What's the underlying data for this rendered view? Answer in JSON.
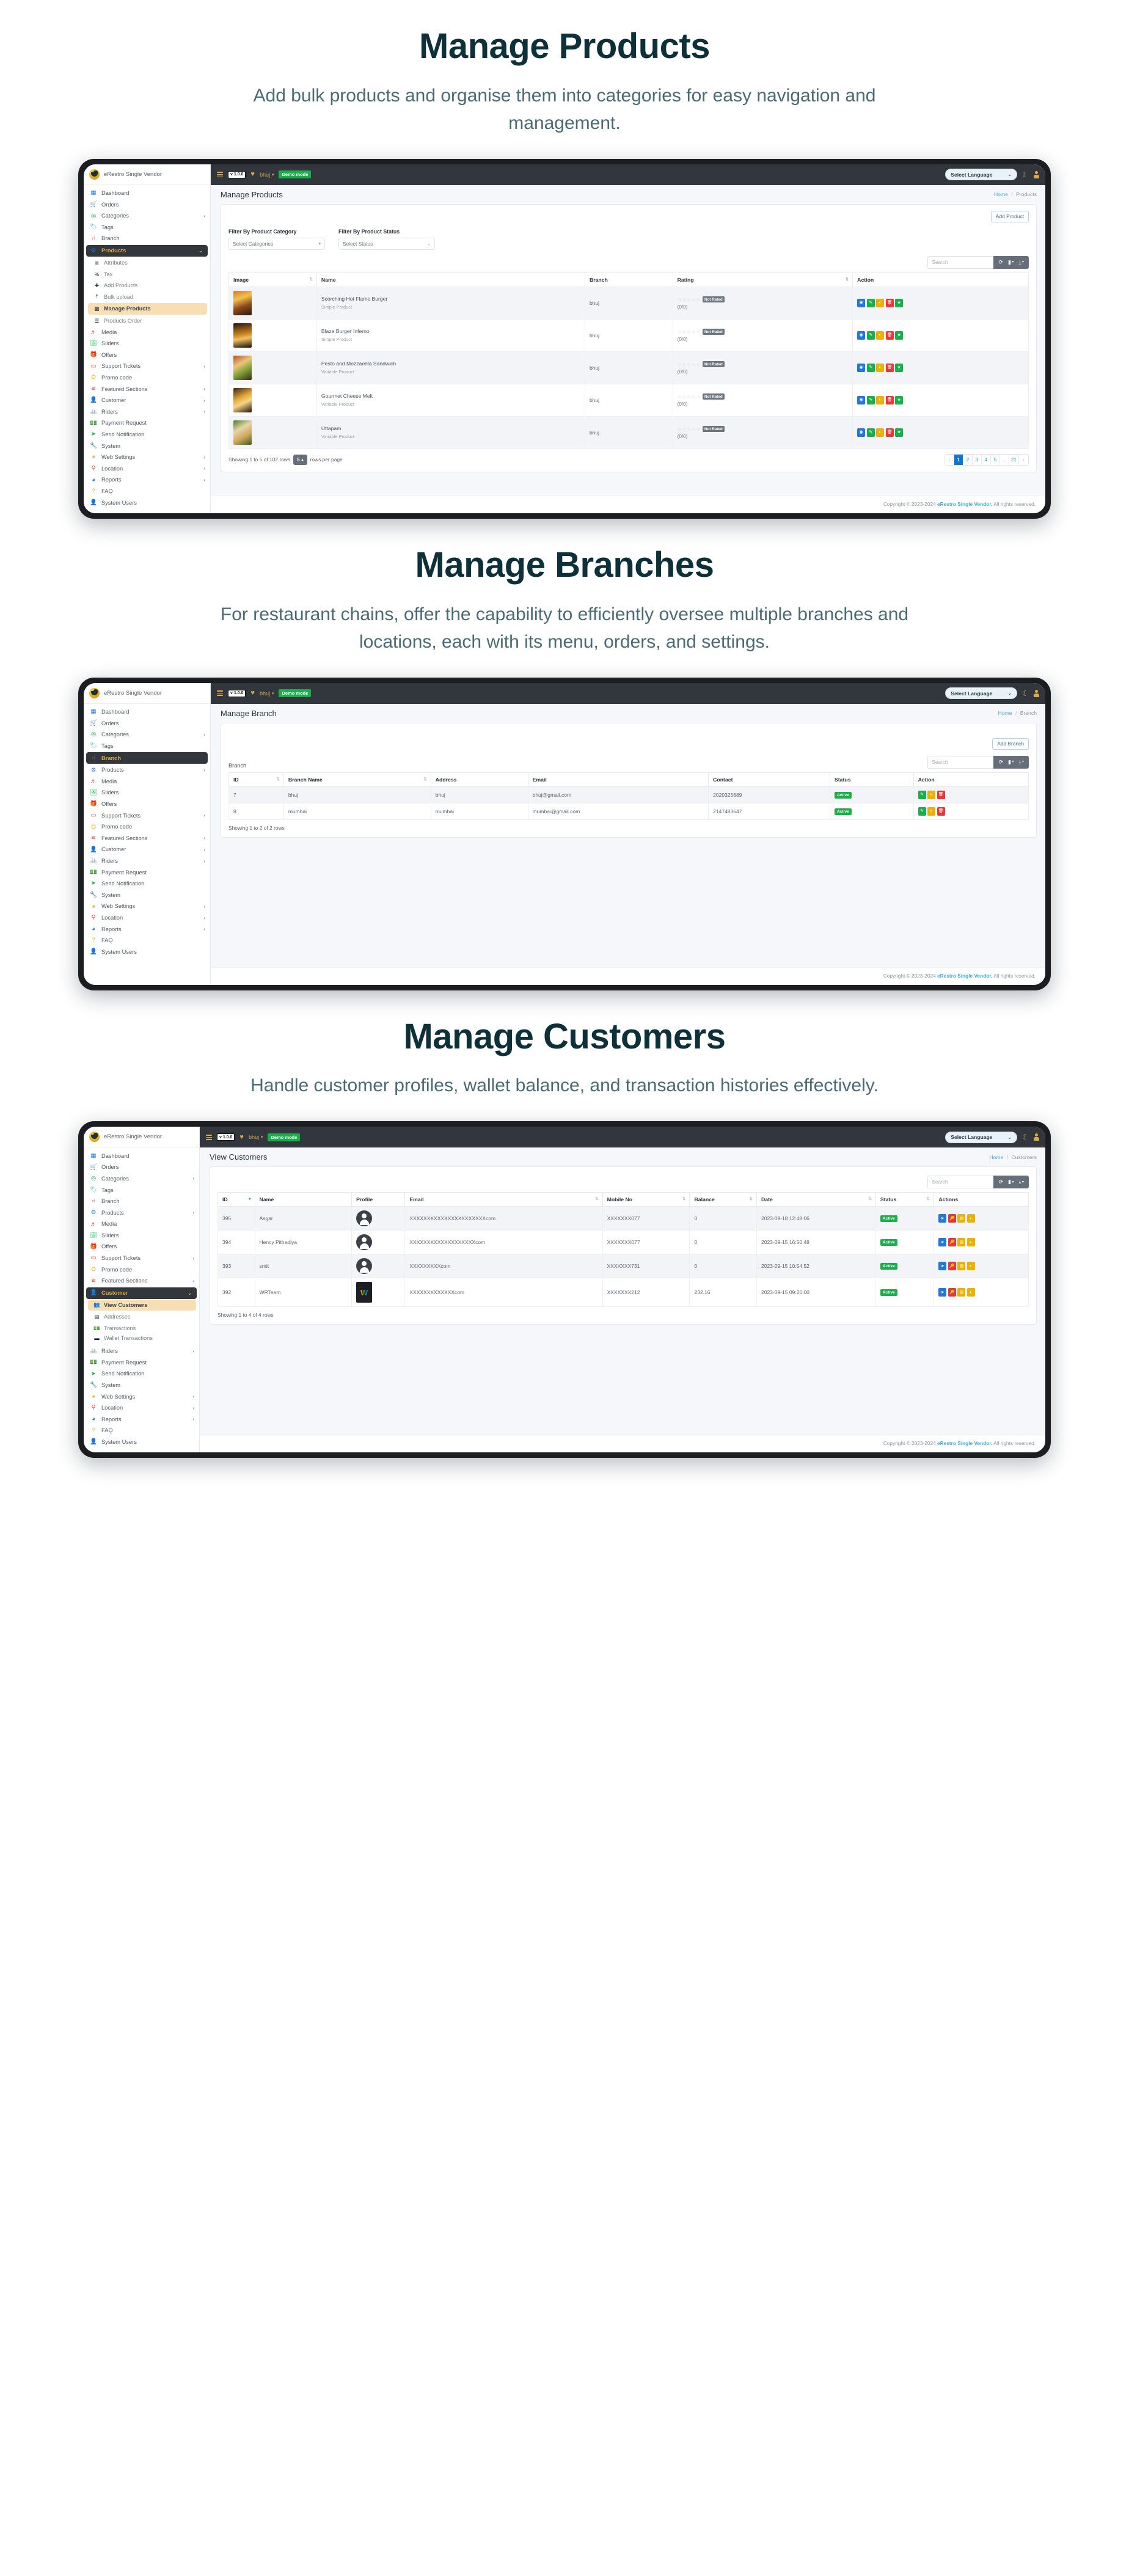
{
  "colors": {
    "accent_gold": "#e0ab47",
    "sidebar_active_bg": "#32373d",
    "submenu_highlight": "#f7dfb3",
    "link_blue": "#3fa9d4",
    "status_green": "#1bae4b",
    "heading": "#0d3039"
  },
  "sections": [
    {
      "title": "Manage Products",
      "subtitle": "Add bulk products and organise them into categories for easy navigation and management."
    },
    {
      "title": "Manage Branches",
      "subtitle": "For restaurant chains, offer the capability to efficiently oversee multiple branches and locations, each with its menu, orders, and settings."
    },
    {
      "title": "Manage Customers",
      "subtitle": "Handle customer profiles, wallet balance, and transaction histories effectively."
    }
  ],
  "brand": {
    "name": "eRestro Single Vendor",
    "logo_icon": "coffee-logo-icon"
  },
  "topbar": {
    "menu_icon": "hamburger-icon",
    "version": "v 1.0.0",
    "heart_icon": "heart-icon",
    "branch": "bhuj",
    "branch_caret": "▾",
    "demo_badge": "Demo mode",
    "language": "Select Language",
    "language_caret": "⌄",
    "theme_icon": "moon-icon",
    "user_icon": "user-icon"
  },
  "footer": {
    "prefix": "Copyright © 2023-2024",
    "brand": "eRestro Single Vendor.",
    "suffix": "All rights reserved."
  },
  "table_tools": {
    "search_placeholder": "Search",
    "refresh_icon": "refresh-icon",
    "columns_icon": "columns-icon",
    "export_icon": "export-icon",
    "caret": "▾"
  },
  "panel_products": {
    "page_title": "Manage Products",
    "breadcrumb_home": "Home",
    "breadcrumb_current": "Products",
    "add_button": "Add Product",
    "filter_category_label": "Filter By Product Category",
    "filter_category_value": "Select Categories",
    "filter_status_label": "Filter By Product Status",
    "filter_status_value": "Select Status",
    "columns": [
      "Image",
      "Name",
      "Branch",
      "Rating",
      "Action"
    ],
    "rows": [
      {
        "name": "Scorching Hot Flame Burger",
        "type": "Simple Product",
        "branch": "bhuj",
        "stars": "☆☆☆☆☆",
        "rating_badge": "Not Rated",
        "ratio": "(0/0)"
      },
      {
        "name": "Blaze Burger Inferno",
        "type": "Simple Product",
        "branch": "bhuj",
        "stars": "☆☆☆☆☆",
        "rating_badge": "Not Rated",
        "ratio": "(0/0)"
      },
      {
        "name": "Pesto and Mozzarella Sandwich",
        "type": "Variable Product",
        "branch": "bhuj",
        "stars": "☆☆☆☆☆",
        "rating_badge": "Not Rated",
        "ratio": "(0/0)"
      },
      {
        "name": "Gourmet Cheese Melt",
        "type": "Variable Product",
        "branch": "bhuj",
        "stars": "☆☆☆☆☆",
        "rating_badge": "Not Rated",
        "ratio": "(0/0)"
      },
      {
        "name": "Uttapam",
        "type": "Variable Product",
        "branch": "bhuj",
        "stars": "☆☆☆☆☆",
        "rating_badge": "Not Rated",
        "ratio": "(0/0)"
      }
    ],
    "row_actions": [
      "view-icon",
      "edit-icon",
      "toggle-icon",
      "delete-icon",
      "feature-icon"
    ],
    "showing": "Showing 1 to 5 of 102 rows",
    "rows_per_page_value": "5",
    "rows_per_page_label": "rows per page",
    "pager": [
      "‹",
      "1",
      "2",
      "3",
      "4",
      "5",
      "...",
      "21",
      "›"
    ],
    "pager_current": "1"
  },
  "panel_branch": {
    "page_title": "Manage Branch",
    "breadcrumb_home": "Home",
    "breadcrumb_current": "Branch",
    "add_button": "Add Branch",
    "table_label": "Branch",
    "columns": [
      "ID",
      "Branch Name",
      "Address",
      "Email",
      "Contact",
      "Status",
      "Action"
    ],
    "rows": [
      {
        "id": "7",
        "name": "bhuj",
        "address": "bhuj",
        "email": "bhuj@gmail.com",
        "contact": "2020325689",
        "status": "Active"
      },
      {
        "id": "8",
        "name": "mumbai",
        "address": "mumbai",
        "email": "mumbai@gmail.com",
        "contact": "2147483647",
        "status": "Active"
      }
    ],
    "row_actions": [
      "edit-icon",
      "toggle-icon",
      "delete-icon"
    ],
    "showing": "Showing 1 to 2 of 2 rows"
  },
  "panel_customers": {
    "page_title": "View Customers",
    "breadcrumb_home": "Home",
    "breadcrumb_current": "Customers",
    "columns": [
      "ID",
      "Name",
      "Profile",
      "Email",
      "Mobile No",
      "Balance",
      "Date",
      "Status",
      "Actions"
    ],
    "rows": [
      {
        "id": "395",
        "name": "Asgar",
        "profile": "avatar-placeholder",
        "email": "XXXXXXXXXXXXXXXXXXXXXXcom",
        "mobile": "XXXXXXX077",
        "balance": "0",
        "date": "2023-09-18 12:48:06",
        "status": "Active"
      },
      {
        "id": "394",
        "name": "Hency Pithadiya",
        "profile": "avatar-placeholder",
        "email": "XXXXXXXXXXXXXXXXXXXcom",
        "mobile": "XXXXXXX077",
        "balance": "0",
        "date": "2023-09-15 16:50:48",
        "status": "Active"
      },
      {
        "id": "393",
        "name": "smit",
        "profile": "avatar-placeholder",
        "email": "XXXXXXXXXcom",
        "mobile": "XXXXXXX731",
        "balance": "0",
        "date": "2023-09-15 10:54:52",
        "status": "Active"
      },
      {
        "id": "392",
        "name": "WRTeam",
        "profile": "avatar-image",
        "email": "XXXXXXXXXXXXXcom",
        "mobile": "XXXXXXX212",
        "balance": "232.16",
        "date": "2023-09-15 09:26:00",
        "status": "Active"
      }
    ],
    "row_actions": [
      "notify-icon",
      "password-icon",
      "wallet-icon",
      "toggle-icon"
    ],
    "showing": "Showing 1 to 4 of 4 rows"
  },
  "sidebar_items": [
    {
      "label": "Dashboard",
      "icon": "grid-icon",
      "glyph": "▦",
      "color": "#2277d8",
      "caret": ""
    },
    {
      "label": "Orders",
      "icon": "cart-icon",
      "glyph": "🛒",
      "color": "#f0a81e",
      "caret": ""
    },
    {
      "label": "Categories",
      "icon": "target-icon",
      "glyph": "◎",
      "color": "#1bae4b",
      "caret": "‹"
    },
    {
      "label": "Tags",
      "icon": "tag-icon",
      "glyph": "🏷",
      "color": "#22b8c4",
      "caret": ""
    },
    {
      "label": "Branch",
      "icon": "branch-icon",
      "glyph": "⑁",
      "color": "#e23a3a",
      "caret": ""
    },
    {
      "label": "Products",
      "icon": "cubes-icon",
      "glyph": "⚙",
      "color": "#2277d8",
      "caret": "‹"
    },
    {
      "label": "Media",
      "icon": "media-icon",
      "glyph": "♬",
      "color": "#e23a3a",
      "caret": ""
    },
    {
      "label": "Sliders",
      "icon": "image-icon",
      "glyph": "🖼",
      "color": "#1bae4b",
      "caret": ""
    },
    {
      "label": "Offers",
      "icon": "gift-icon",
      "glyph": "🎁",
      "color": "#2277d8",
      "caret": ""
    },
    {
      "label": "Support Tickets",
      "icon": "ticket-icon",
      "glyph": "▭",
      "color": "#e23a3a",
      "caret": "‹"
    },
    {
      "label": "Promo code",
      "icon": "promo-icon",
      "glyph": "⛭",
      "color": "#f0a81e",
      "caret": ""
    },
    {
      "label": "Featured Sections",
      "icon": "layers-icon",
      "glyph": "≋",
      "color": "#e23a3a",
      "caret": "‹"
    },
    {
      "label": "Customer",
      "icon": "person-icon",
      "glyph": "👤",
      "color": "#1bae4b",
      "caret": "‹"
    },
    {
      "label": "Riders",
      "icon": "bike-icon",
      "glyph": "🚲",
      "color": "#22b8c4",
      "caret": "‹"
    },
    {
      "label": "Payment Request",
      "icon": "money-icon",
      "glyph": "💵",
      "color": "#e23a3a",
      "caret": ""
    },
    {
      "label": "Send Notification",
      "icon": "send-icon",
      "glyph": "➤",
      "color": "#1bae4b",
      "caret": ""
    },
    {
      "label": "System",
      "icon": "wrench-icon",
      "glyph": "🔧",
      "color": "#2277d8",
      "caret": ""
    },
    {
      "label": "Web Settings",
      "icon": "globe-icon",
      "glyph": "◕",
      "color": "#f0a81e",
      "caret": "‹"
    },
    {
      "label": "Location",
      "icon": "map-pin-icon",
      "glyph": "⚲",
      "color": "#e23a3a",
      "caret": "‹"
    },
    {
      "label": "Reports",
      "icon": "pie-chart-icon",
      "glyph": "◕",
      "color": "#2277d8",
      "caret": "‹"
    },
    {
      "label": "FAQ",
      "icon": "question-icon",
      "glyph": "?",
      "color": "#f0a81e",
      "caret": ""
    },
    {
      "label": "System Users",
      "icon": "user-tie-icon",
      "glyph": "👤",
      "color": "#e23a3a",
      "caret": ""
    }
  ],
  "products_submenu": [
    {
      "label": "Attributes",
      "icon": "sliders-icon",
      "glyph": "≣"
    },
    {
      "label": "Tax",
      "icon": "percent-icon",
      "glyph": "%"
    },
    {
      "label": "Add Products",
      "icon": "plus-box-icon",
      "glyph": "✚"
    },
    {
      "label": "Bulk upload",
      "icon": "upload-icon",
      "glyph": "⤒"
    },
    {
      "label": "Manage Products",
      "icon": "boxes-icon",
      "glyph": "▩"
    },
    {
      "label": "Products Order",
      "icon": "list-icon",
      "glyph": "☰"
    }
  ],
  "customer_submenu": [
    {
      "label": "View Customers",
      "icon": "users-icon",
      "glyph": "👥"
    },
    {
      "label": "Addresses",
      "icon": "address-card-icon",
      "glyph": "▤"
    },
    {
      "label": "Transactions",
      "icon": "cash-icon",
      "glyph": "💵"
    },
    {
      "label": "Wallet Transactions",
      "icon": "wallet-icon",
      "glyph": "▬"
    }
  ],
  "active": {
    "products_parent": "Products",
    "products_child": "Manage Products",
    "branch_item": "Branch",
    "customer_parent": "Customer",
    "customer_child": "View Customers"
  }
}
